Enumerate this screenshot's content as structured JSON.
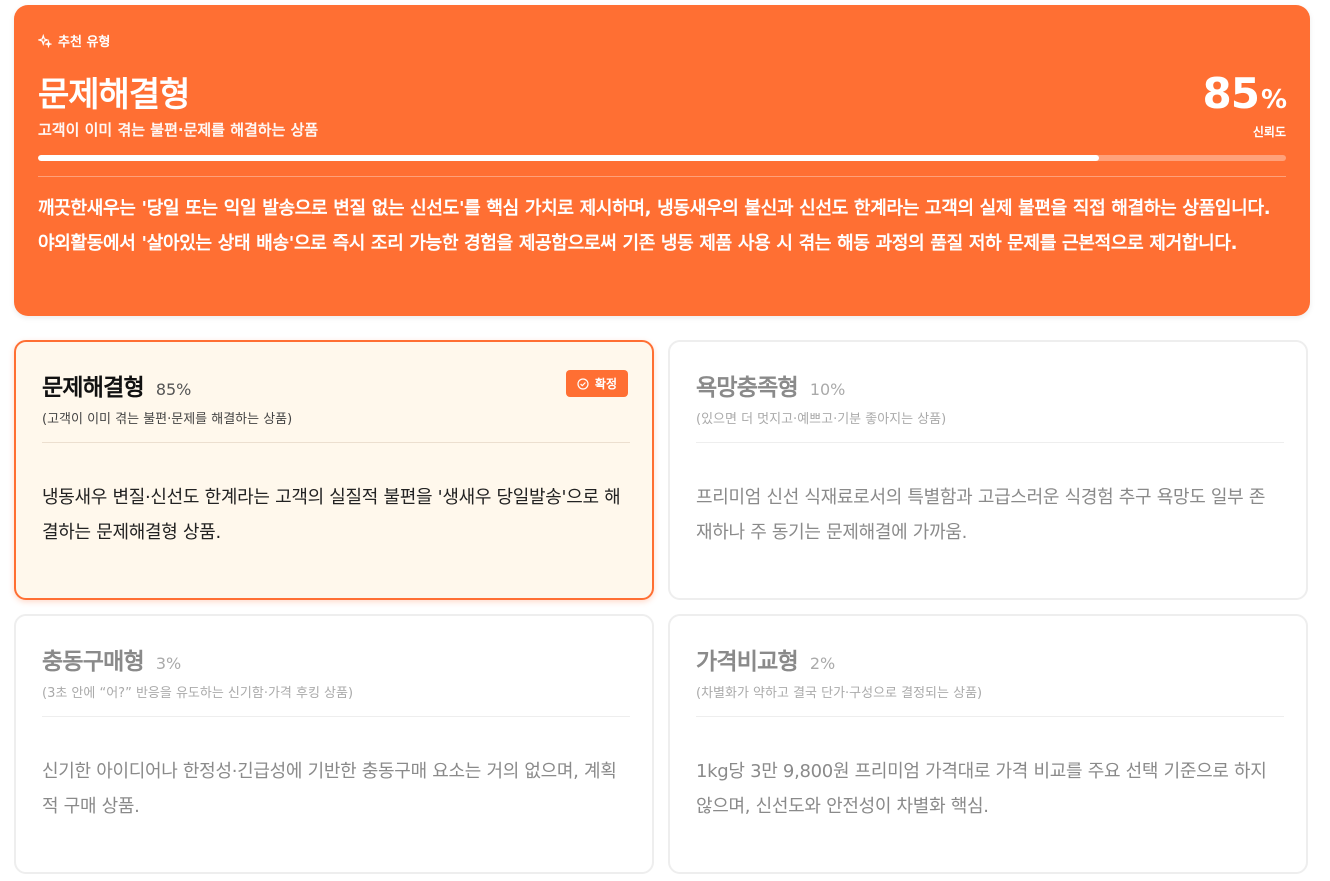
{
  "hero": {
    "tag_icon": "sparkle-icon",
    "tag": "추천 유형",
    "title": "문제해결형",
    "subtitle": "고객이 이미 겪는 불편·문제를 해결하는 상품",
    "percent": "85",
    "percent_unit": "%",
    "confidence_label": "신뢰도",
    "confidence_value": 0.85,
    "description": "깨끗한새우는 '당일 또는 익일 발송으로 변질 없는 신선도'를 핵심 가치로 제시하며, 냉동새우의 불신과 신선도 한계라는 고객의 실제 불편을 직접 해결하는 상품입니다. 야외활동에서 '살아있는 상태 배송'으로 즉시 조리 가능한 경험을 제공함으로써 기존 냉동 제품 사용 시 겪는 해동 과정의 품질 저하 문제를 근본적으로 제거합니다."
  },
  "cards": [
    {
      "title": "문제해결형",
      "percent": "85%",
      "subtitle": "(고객이 이미 겪는 불편·문제를 해결하는 상품)",
      "body": "냉동새우 변질·신선도 한계라는 고객의 실질적 불편을 '생새우 당일발송'으로 해결하는 문제해결형 상품.",
      "badge": "확정",
      "badge_icon": "check-circle-icon"
    },
    {
      "title": "욕망충족형",
      "percent": "10%",
      "subtitle": "(있으면 더 멋지고·예쁘고·기분 좋아지는 상품)",
      "body": "프리미엄 신선 식재료로서의 특별함과 고급스러운 식경험 추구 욕망도 일부 존재하나 주 동기는 문제해결에 가까움."
    },
    {
      "title": "충동구매형",
      "percent": "3%",
      "subtitle": "(3초 안에 “어?” 반응을 유도하는 신기함·가격 후킹 상품)",
      "body": "신기한 아이디어나 한정성·긴급성에 기반한 충동구매 요소는 거의 없으며, 계획적 구매 상품."
    },
    {
      "title": "가격비교형",
      "percent": "2%",
      "subtitle": "(차별화가 약하고 결국 단가·구성으로 결정되는 상품)",
      "body": "1kg당 3만 9,800원 프리미엄 가격대로 가격 비교를 주요 선택 기준으로 하지 않으며, 신선도와 안전성이 차별화 핵심."
    }
  ],
  "colors": {
    "accent": "#ff6f33",
    "active_card_bg": "#fff8ec"
  }
}
